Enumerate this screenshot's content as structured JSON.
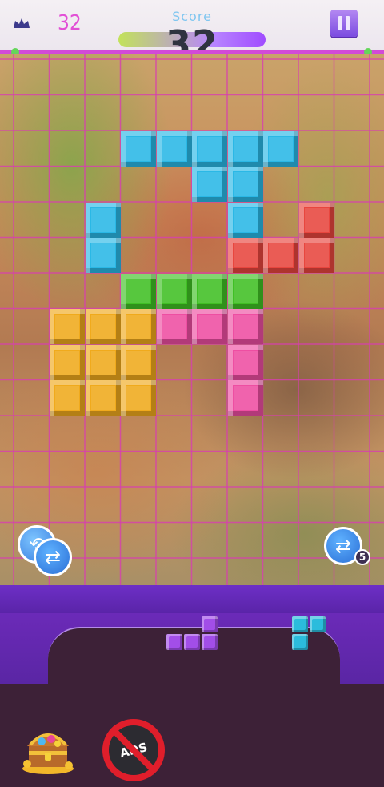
{
  "header": {
    "best_score": "32",
    "score_label": "Score",
    "score": "32",
    "progress_fraction": 1.0
  },
  "colors": {
    "cyan": "#2ab8e6",
    "red": "#e8463e",
    "green": "#40c024",
    "yellow": "#f0aa1c",
    "pink": "#ee4ea2",
    "purple": "#a24ee8",
    "grid_line": "#d83fb0",
    "tray_cyan": "#2bbcdc"
  },
  "board": {
    "cols": 10,
    "rows": 15,
    "cells": [
      {
        "r": 2,
        "c": 3,
        "color": "cyan"
      },
      {
        "r": 2,
        "c": 4,
        "color": "cyan"
      },
      {
        "r": 2,
        "c": 5,
        "color": "cyan"
      },
      {
        "r": 2,
        "c": 6,
        "color": "cyan"
      },
      {
        "r": 2,
        "c": 7,
        "color": "cyan"
      },
      {
        "r": 3,
        "c": 5,
        "color": "cyan"
      },
      {
        "r": 3,
        "c": 6,
        "color": "cyan"
      },
      {
        "r": 4,
        "c": 2,
        "color": "cyan"
      },
      {
        "r": 4,
        "c": 6,
        "color": "cyan"
      },
      {
        "r": 4,
        "c": 8,
        "color": "red"
      },
      {
        "r": 5,
        "c": 2,
        "color": "cyan"
      },
      {
        "r": 5,
        "c": 6,
        "color": "red"
      },
      {
        "r": 5,
        "c": 7,
        "color": "red"
      },
      {
        "r": 5,
        "c": 8,
        "color": "red"
      },
      {
        "r": 6,
        "c": 3,
        "color": "green"
      },
      {
        "r": 6,
        "c": 4,
        "color": "green"
      },
      {
        "r": 6,
        "c": 5,
        "color": "green"
      },
      {
        "r": 6,
        "c": 6,
        "color": "green"
      },
      {
        "r": 7,
        "c": 1,
        "color": "yellow"
      },
      {
        "r": 7,
        "c": 2,
        "color": "yellow"
      },
      {
        "r": 7,
        "c": 3,
        "color": "yellow"
      },
      {
        "r": 7,
        "c": 4,
        "color": "pink"
      },
      {
        "r": 7,
        "c": 5,
        "color": "pink"
      },
      {
        "r": 7,
        "c": 6,
        "color": "pink"
      },
      {
        "r": 8,
        "c": 1,
        "color": "yellow"
      },
      {
        "r": 8,
        "c": 2,
        "color": "yellow"
      },
      {
        "r": 8,
        "c": 3,
        "color": "yellow"
      },
      {
        "r": 8,
        "c": 6,
        "color": "pink"
      },
      {
        "r": 9,
        "c": 1,
        "color": "yellow"
      },
      {
        "r": 9,
        "c": 2,
        "color": "yellow"
      },
      {
        "r": 9,
        "c": 3,
        "color": "yellow"
      },
      {
        "r": 9,
        "c": 6,
        "color": "pink"
      }
    ]
  },
  "controls": {
    "rotate_icon": "rotate-arrows-icon",
    "swap_icon": "swap-arrows-icon",
    "swap_count": "5"
  },
  "tray": {
    "pieces": [
      {
        "name": "purple-l-piece",
        "color": "purple",
        "cells": [
          [
            0,
            2
          ],
          [
            1,
            0
          ],
          [
            1,
            1
          ],
          [
            1,
            2
          ]
        ]
      },
      {
        "name": "cyan-corner-piece",
        "color": "tray_cyan",
        "cells": [
          [
            0,
            0
          ],
          [
            0,
            1
          ],
          [
            1,
            0
          ]
        ]
      }
    ]
  },
  "bottom": {
    "chest_icon": "treasure-chest-icon",
    "no_ads_label": "ADS"
  }
}
